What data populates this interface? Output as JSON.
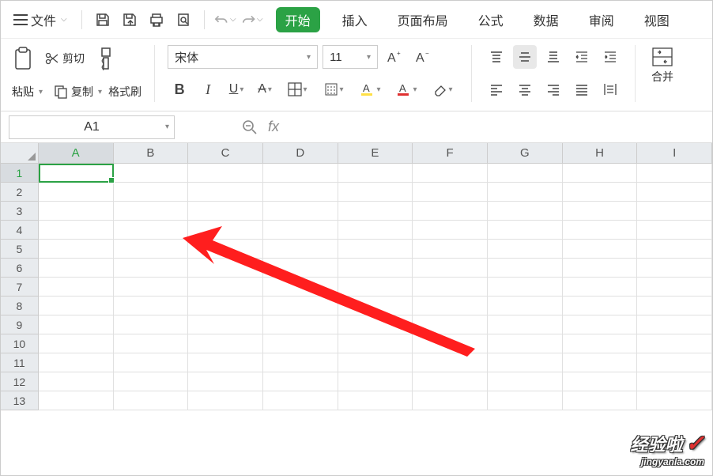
{
  "menubar": {
    "file_label": "文件",
    "tabs": [
      "开始",
      "插入",
      "页面布局",
      "公式",
      "数据",
      "审阅",
      "视图"
    ]
  },
  "ribbon": {
    "paste_label": "粘贴",
    "cut_label": "剪切",
    "copy_label": "复制",
    "format_painter_label": "格式刷",
    "font_name": "宋体",
    "font_size": "11",
    "merge_label": "合并"
  },
  "fxbar": {
    "cell_ref": "A1",
    "fx_label": "fx"
  },
  "sheet": {
    "columns": [
      "A",
      "B",
      "C",
      "D",
      "E",
      "F",
      "G",
      "H",
      "I"
    ],
    "rows": [
      "1",
      "2",
      "3",
      "4",
      "5",
      "6",
      "7",
      "8",
      "9",
      "10",
      "11",
      "12",
      "13"
    ],
    "active_col": "A",
    "active_row": "1"
  },
  "watermark": {
    "line1": "经验啦",
    "line2": "jingyanla.com"
  }
}
